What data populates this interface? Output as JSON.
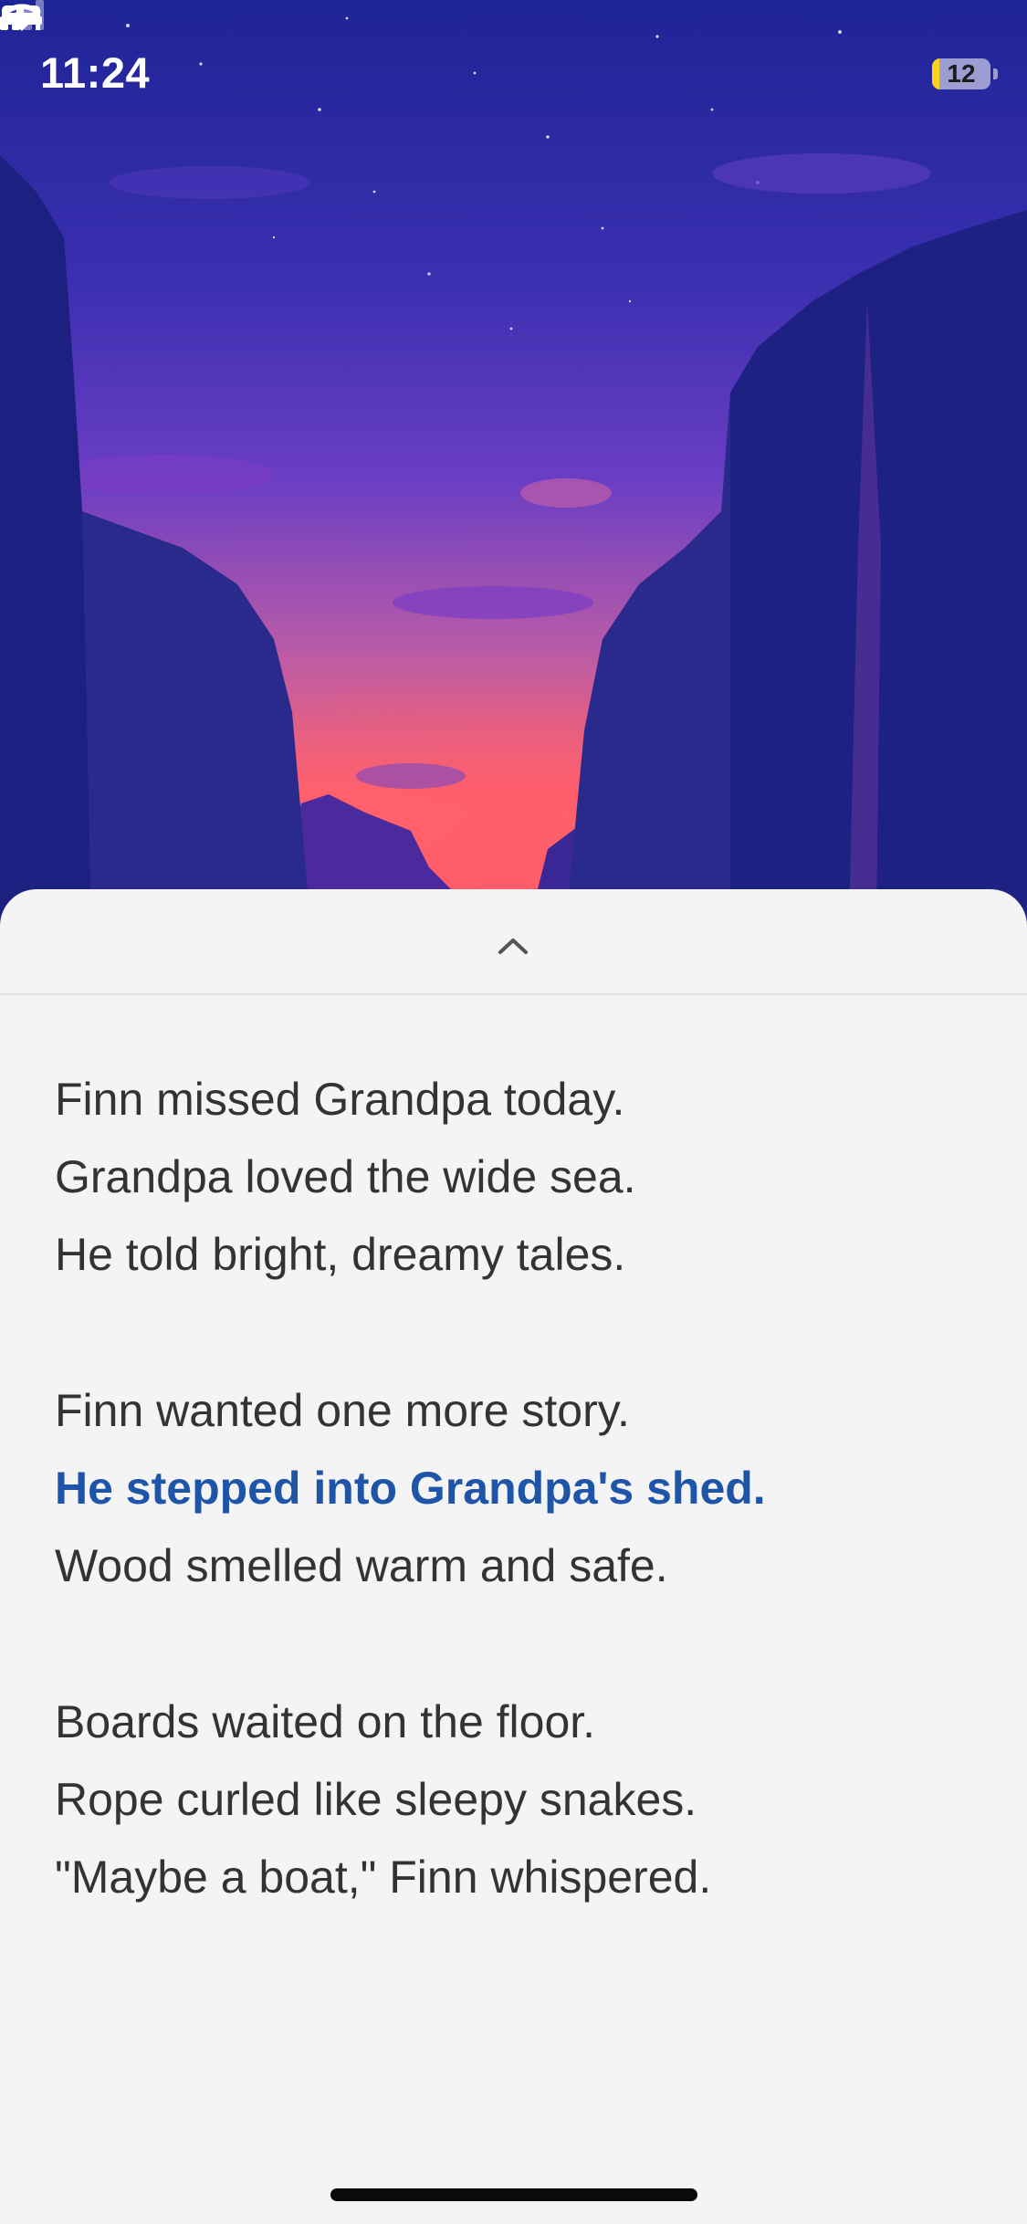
{
  "status_bar": {
    "time": "11:24",
    "focus_icon": "bed-icon",
    "battery_level": "12",
    "battery_fraction": 0.12
  },
  "illustration": {
    "subject": "canyon-at-dusk"
  },
  "sheet": {
    "handle_icon": "chevron-up-icon",
    "stanzas": [
      {
        "lines": [
          "Finn missed Grandpa today.",
          "Grandpa loved the wide sea.",
          "He told bright, dreamy tales."
        ]
      },
      {
        "lines": [
          "Finn wanted one more story.",
          "He stepped into Grandpa's shed.",
          "Wood smelled warm and safe."
        ]
      },
      {
        "lines": [
          "Boards waited on the floor.",
          "Rope curled like sleepy snakes.",
          "\"Maybe a boat,\" Finn whispered."
        ]
      }
    ],
    "highlight_color": "#1f55a8",
    "text_color": "#333333"
  }
}
